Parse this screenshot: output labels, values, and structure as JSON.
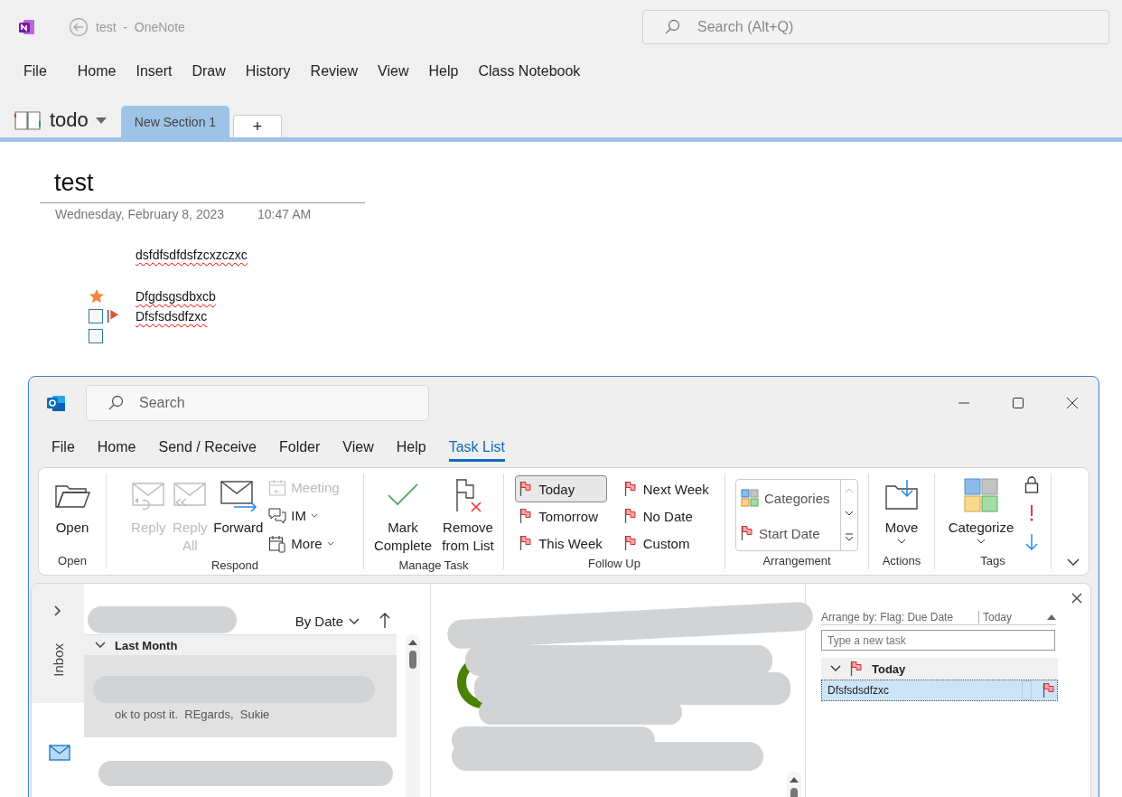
{
  "onenote": {
    "title": "test  -  OneNote",
    "search": {
      "placeholder": "Search (Alt+Q)"
    },
    "menu": [
      {
        "label": "File"
      },
      {
        "label": "Home"
      },
      {
        "label": "Insert"
      },
      {
        "label": "Draw"
      },
      {
        "label": "History"
      },
      {
        "label": "Review"
      },
      {
        "label": "View"
      },
      {
        "label": "Help"
      },
      {
        "label": "Class Notebook"
      }
    ],
    "notebook": "todo",
    "sections": [
      {
        "label": "New Section 1",
        "selected": true
      }
    ],
    "add_section": "+",
    "page": {
      "title": "test",
      "date": "Wednesday, February 8, 2023",
      "time": "10:47 AM",
      "lines": [
        {
          "text": "dsfdfsdfdsfzcxzczxc"
        },
        {
          "text": "Dfgdsgsdbxcb",
          "tags": [
            {
              "kind": "star"
            }
          ]
        },
        {
          "text": "Dfsfsdsdfzxc",
          "tags": [
            {
              "kind": "checkbox",
              "checked": false
            },
            {
              "kind": "flag"
            }
          ]
        },
        {
          "tags": [
            {
              "kind": "checkbox",
              "checked": false
            }
          ]
        }
      ]
    }
  },
  "outlook": {
    "search": {
      "placeholder": "Search"
    },
    "tabs": [
      {
        "label": "File",
        "selected": false
      },
      {
        "label": "Home",
        "selected": false
      },
      {
        "label": "Send / Receive",
        "selected": false
      },
      {
        "label": "Folder",
        "selected": false
      },
      {
        "label": "View",
        "selected": false
      },
      {
        "label": "Help",
        "selected": false
      },
      {
        "label": "Task List",
        "selected": true
      }
    ],
    "ribbon": [
      {
        "label": "Open",
        "items": [
          {
            "kind": "large",
            "label": "Open",
            "disabled": false
          }
        ]
      },
      {
        "label": "Respond",
        "items": [
          {
            "kind": "large",
            "label": "Reply",
            "disabled": true
          },
          {
            "kind": "large",
            "label": "Reply All",
            "disabled": true
          },
          {
            "kind": "large",
            "label": "Forward",
            "disabled": false
          },
          {
            "kind": "small",
            "label": "Meeting",
            "disabled": true,
            "dropdown": false
          },
          {
            "kind": "small",
            "label": "IM",
            "disabled": false,
            "dropdown": true
          },
          {
            "kind": "small",
            "label": "More",
            "disabled": false,
            "dropdown": true
          }
        ]
      },
      {
        "label": "Manage Task",
        "items": [
          {
            "kind": "large",
            "label": "Mark Complete",
            "disabled": false
          },
          {
            "kind": "large",
            "label": "Remove from List",
            "disabled": false
          }
        ]
      },
      {
        "label": "Follow Up",
        "items": [
          {
            "kind": "flag",
            "label": "Today",
            "selected": true
          },
          {
            "kind": "flag",
            "label": "Tomorrow",
            "selected": false
          },
          {
            "kind": "flag",
            "label": "This Week",
            "selected": false
          },
          {
            "kind": "flag",
            "label": "Next Week",
            "selected": false
          },
          {
            "kind": "flag",
            "label": "No Date",
            "selected": false
          },
          {
            "kind": "flag",
            "label": "Custom",
            "selected": false
          }
        ]
      },
      {
        "label": "Arrangement",
        "items": [
          {
            "kind": "gallery",
            "label": "Categories"
          },
          {
            "kind": "gallery",
            "label": "Start Date"
          }
        ]
      },
      {
        "label": "Actions",
        "items": [
          {
            "kind": "large",
            "label": "Move",
            "disabled": false,
            "dropdown": true
          }
        ]
      },
      {
        "label": "Tags",
        "items": [
          {
            "kind": "large",
            "label": "Categorize",
            "disabled": false,
            "dropdown": true
          },
          {
            "kind": "icon"
          },
          {
            "kind": "icon"
          },
          {
            "kind": "icon"
          }
        ]
      }
    ],
    "nav": {
      "folder": "Inbox"
    },
    "list": {
      "sort": "By Date",
      "groups": [
        {
          "label": "Last Month",
          "expanded": true,
          "messages": [
            {
              "preview": "ok to post it.  REgards,  Sukie",
              "selected": true
            }
          ]
        }
      ]
    },
    "todo": {
      "arrange": "Arrange by: Flag: Due Date",
      "column": "Today",
      "new_task": {
        "placeholder": "Type a new task"
      },
      "groups": [
        {
          "label": "Today",
          "expanded": true,
          "tasks": [
            {
              "text": "Dfsfsdsdfzxc",
              "selected": true
            }
          ]
        }
      ]
    }
  }
}
